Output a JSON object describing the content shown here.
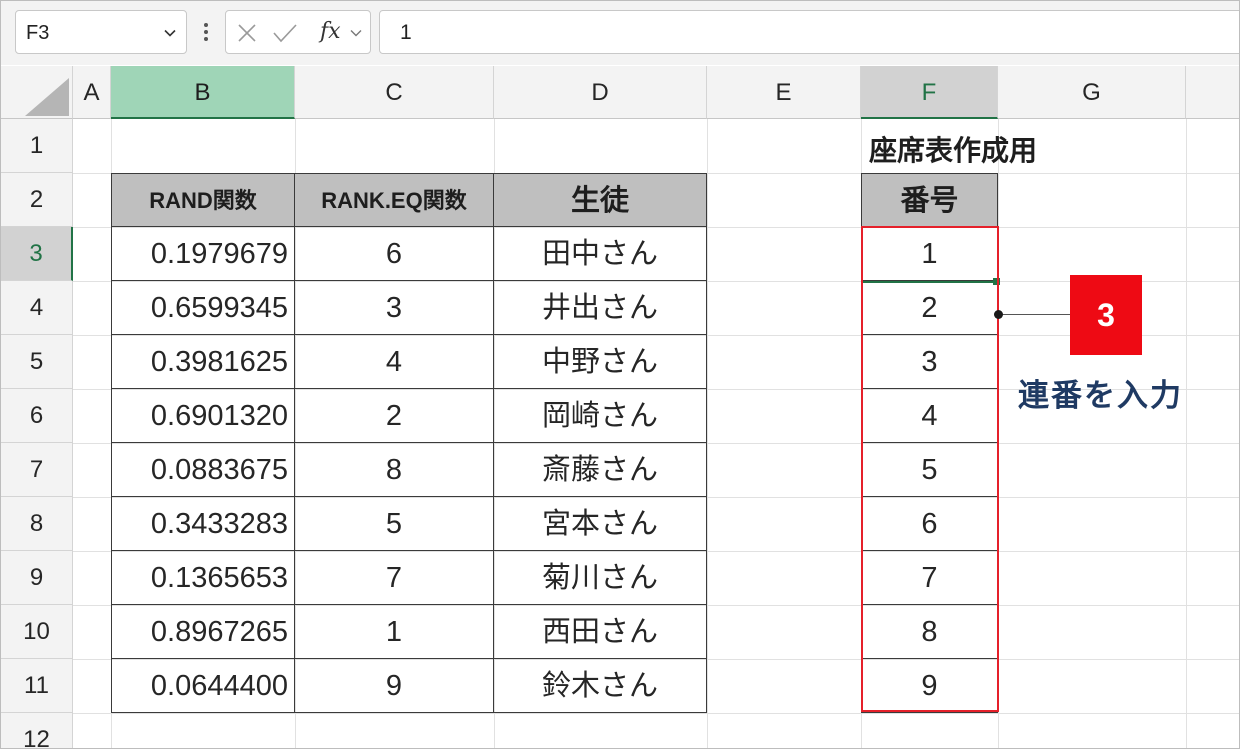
{
  "formula_bar": {
    "name_box": "F3",
    "fx_label": "fx",
    "formula_value": "1",
    "icons": [
      "chevron-down-icon",
      "more-icon",
      "cancel-icon",
      "enter-icon",
      "fx-icon",
      "chevron-down-icon"
    ]
  },
  "columns": [
    "A",
    "B",
    "C",
    "D",
    "E",
    "F",
    "G"
  ],
  "rows": [
    "1",
    "2",
    "3",
    "4",
    "5",
    "6",
    "7",
    "8",
    "9",
    "10",
    "11",
    "12"
  ],
  "sheet": {
    "seat_title": "座席表作成用",
    "headers": {
      "rand": "RAND関数",
      "rank": "RANK.EQ関数",
      "student": "生徒",
      "number": "番号"
    },
    "data": [
      {
        "rand": "0.1979679",
        "rank": "6",
        "student": "田中さん",
        "number": "1"
      },
      {
        "rand": "0.6599345",
        "rank": "3",
        "student": "井出さん",
        "number": "2"
      },
      {
        "rand": "0.3981625",
        "rank": "4",
        "student": "中野さん",
        "number": "3"
      },
      {
        "rand": "0.6901320",
        "rank": "2",
        "student": "岡崎さん",
        "number": "4"
      },
      {
        "rand": "0.0883675",
        "rank": "8",
        "student": "斎藤さん",
        "number": "5"
      },
      {
        "rand": "0.3433283",
        "rank": "5",
        "student": "宮本さん",
        "number": "6"
      },
      {
        "rand": "0.1365653",
        "rank": "7",
        "student": "菊川さん",
        "number": "7"
      },
      {
        "rand": "0.8967265",
        "rank": "1",
        "student": "西田さん",
        "number": "8"
      },
      {
        "rand": "0.0644400",
        "rank": "9",
        "student": "鈴木さん",
        "number": "9"
      }
    ]
  },
  "annotation": {
    "step": "3",
    "text": "連番を入力"
  },
  "colors": {
    "accent_green": "#217346",
    "highlight_red": "#e5202a",
    "badge_red": "#ee0a14",
    "note_navy": "#1f3a63"
  }
}
